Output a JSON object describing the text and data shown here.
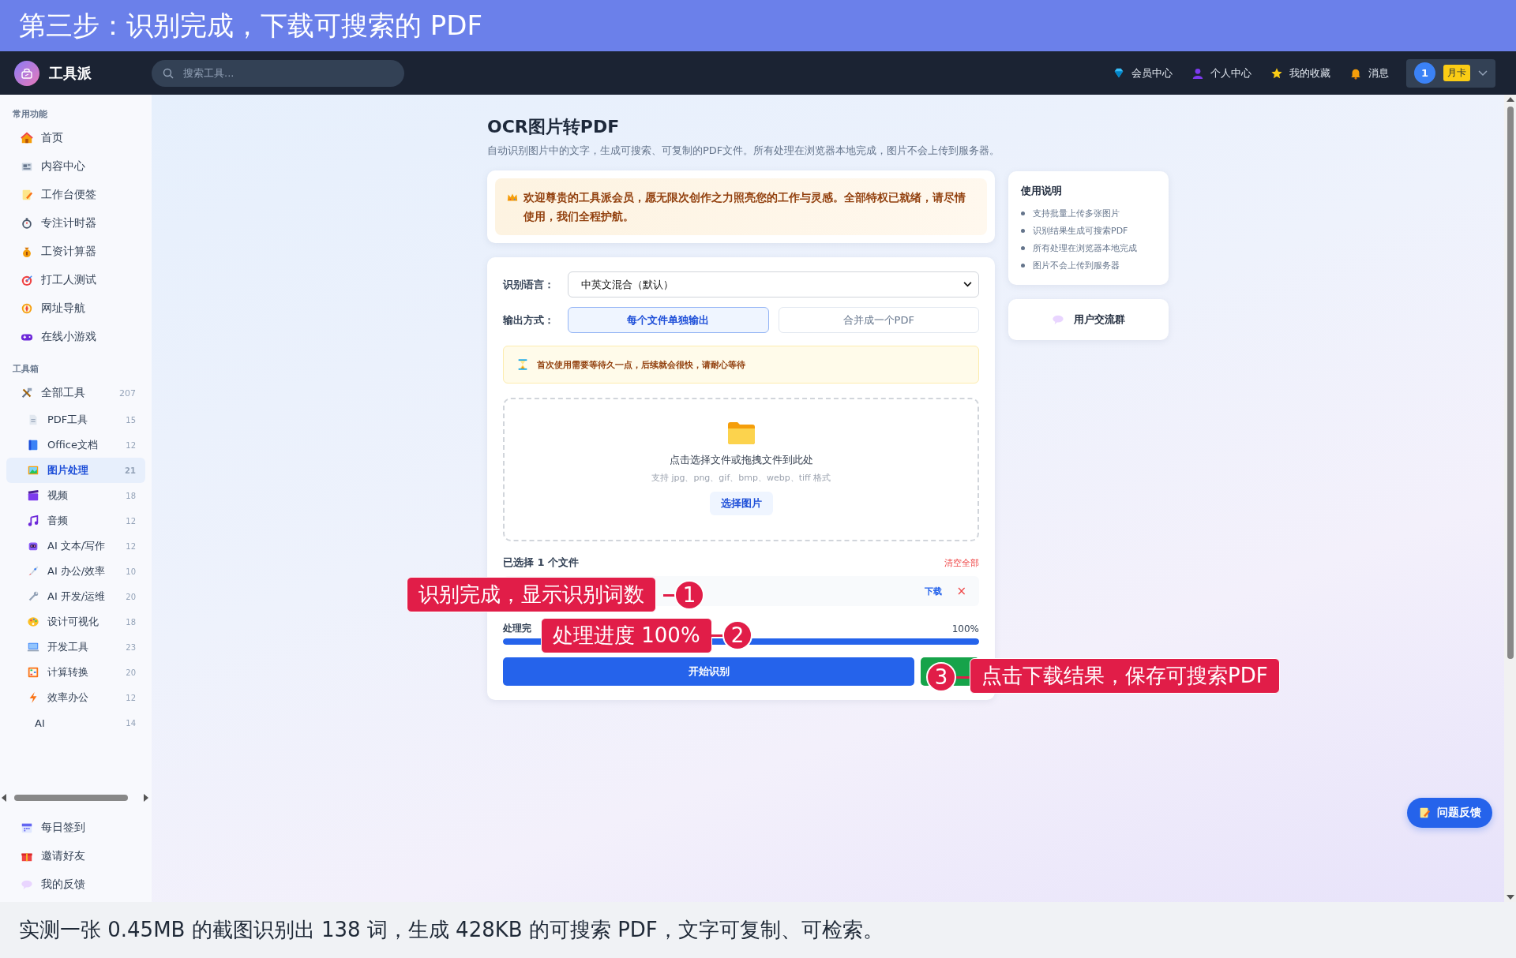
{
  "banner": {
    "title": "第三步：识别完成，下载可搜索的 PDF"
  },
  "navbar": {
    "brand": "工具派",
    "search": {
      "placeholder": "搜索工具..."
    },
    "links": [
      {
        "label": "会员中心"
      },
      {
        "label": "个人中心"
      },
      {
        "label": "我的收藏"
      },
      {
        "label": "消息"
      }
    ],
    "user": {
      "avatar": "1",
      "badge": "月卡"
    }
  },
  "sidebar": {
    "sections": [
      {
        "title": "常用功能",
        "items": [
          {
            "label": "首页",
            "selected": false
          },
          {
            "label": "内容中心",
            "selected": false
          },
          {
            "label": "工作台便签",
            "selected": false
          },
          {
            "label": "专注计时器",
            "selected": false
          },
          {
            "label": "工资计算器",
            "selected": false
          },
          {
            "label": "打工人测试",
            "selected": false
          },
          {
            "label": "网址导航",
            "selected": false
          },
          {
            "label": "在线小游戏",
            "selected": false
          }
        ]
      },
      {
        "title": "工具箱",
        "items": [
          {
            "label": "全部工具",
            "count": "207",
            "selected": false,
            "children": [
              {
                "label": "PDF工具",
                "count": "15",
                "selected": false
              },
              {
                "label": "Office文档",
                "count": "12",
                "selected": false
              },
              {
                "label": "图片处理",
                "count": "21",
                "selected": true
              },
              {
                "label": "视频",
                "count": "18",
                "selected": false
              },
              {
                "label": "音频",
                "count": "12",
                "selected": false
              },
              {
                "label": "AI 文本/写作",
                "count": "12",
                "selected": false
              },
              {
                "label": "AI 办公/效率",
                "count": "10",
                "selected": false
              },
              {
                "label": "AI 开发/运维",
                "count": "20",
                "selected": false
              },
              {
                "label": "设计可视化",
                "count": "18",
                "selected": false
              },
              {
                "label": "开发工具",
                "count": "23",
                "selected": false
              },
              {
                "label": "计算转换",
                "count": "20",
                "selected": false
              },
              {
                "label": "效率办公",
                "count": "12",
                "selected": false
              },
              {
                "label": "AI",
                "count": "14",
                "selected": false
              }
            ]
          }
        ]
      }
    ],
    "footer_items": [
      {
        "label": "每日签到"
      },
      {
        "label": "邀请好友"
      },
      {
        "label": "我的反馈"
      }
    ]
  },
  "page": {
    "title": "OCR图片转PDF",
    "subtitle": "自动识别图片中的文字，生成可搜索、可复制的PDF文件。所有处理在浏览器本地完成，图片不会上传到服务器。"
  },
  "welcome": {
    "text": "欢迎尊贵的工具派会员，愿无限次创作之力照亮您的工作与灵感。全部特权已就绪，请尽情使用，我们全程护航。"
  },
  "form": {
    "language": {
      "label": "识别语言：",
      "value": "中英文混合（默认）"
    },
    "output": {
      "label": "输出方式：",
      "options": [
        {
          "label": "每个文件单独输出",
          "selected": true
        },
        {
          "label": "合并成一个PDF",
          "selected": false
        }
      ]
    },
    "tip": "首次使用需要等待久一点，后续就会很快，请耐心等待",
    "dropzone": {
      "text": "点击选择文件或拖拽文件到此处",
      "formats": "支持 jpg、png、gif、bmp、webp、tiff 格式",
      "button": "选择图片"
    },
    "files": {
      "label": "已选择 1 个文件",
      "clear": "清空全部",
      "rows": [
        {
          "download": "下载",
          "remove": "×"
        }
      ]
    },
    "progress": {
      "label": "处理完",
      "reading": "100%",
      "level": 1
    },
    "start_button": "开始识别"
  },
  "guide": {
    "title": "使用说明",
    "items": [
      "支持批量上传多张图片",
      "识别结果生成可搜索PDF",
      "所有处理在浏览器本地完成",
      "图片不会上传到服务器"
    ]
  },
  "community": {
    "label": "用户交流群"
  },
  "feedback": {
    "label": "问题反馈"
  },
  "annotations": [
    {
      "number": "1",
      "text": "识别完成，显示识别词数"
    },
    {
      "number": "2",
      "text": "处理进度 100%"
    },
    {
      "number": "3",
      "text": "点击下载结果，保存可搜索PDF"
    }
  ],
  "caption": "实测一张 0.45MB 的截图识别出 138 词，生成 428KB 的可搜索 PDF，文字可复制、可检索。"
}
